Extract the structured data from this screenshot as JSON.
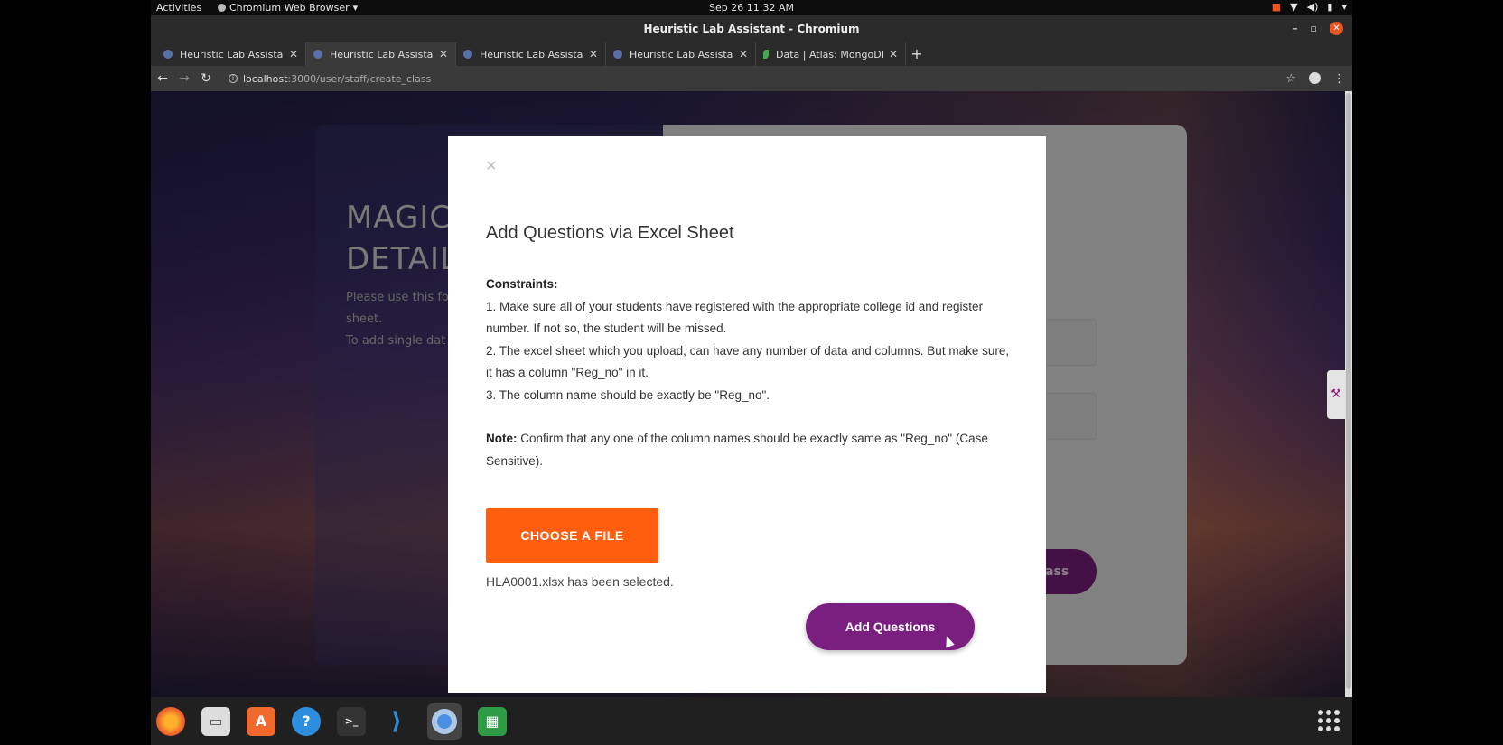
{
  "system": {
    "activities": "Activities",
    "app_menu": "Chromium Web Browser",
    "clock": "Sep 26  11:32 AM"
  },
  "window": {
    "title": "Heuristic Lab Assistant - Chromium"
  },
  "tabs": [
    {
      "label": "Heuristic Lab Assistant",
      "active": false
    },
    {
      "label": "Heuristic Lab Assistant",
      "active": true
    },
    {
      "label": "Heuristic Lab Assistant",
      "active": false
    },
    {
      "label": "Heuristic Lab Assistant",
      "active": false
    },
    {
      "label": "Data | Atlas: MongoDB At",
      "active": false
    }
  ],
  "toolbar": {
    "url_host": "localhost",
    "url_rest": ":3000/user/staff/create_class"
  },
  "background_card": {
    "heading_line1": "MAGIC",
    "heading_line2": "DETAIL",
    "text_line1": "Please use this fo",
    "text_line2": "sheet.",
    "text_line3": "To add single dat",
    "button_label": "Class"
  },
  "modal": {
    "close_symbol": "×",
    "title": "Add Questions via Excel Sheet",
    "constraints_label": "Constraints:",
    "constraint_1": "1. Make sure all of your students have registered with the appropriate college id and register number. If not so, the student will be missed.",
    "constraint_2": "2. The excel sheet which you upload, can have any number of data and columns. But make sure, it has a column \"Reg_no\" in it.",
    "constraint_3": "3. The column name should be exactly be \"Reg_no\".",
    "note_label": "Note:",
    "note_text": " Confirm that any one of the column names should be exactly same as \"Reg_no\" (Case Sensitive).",
    "choose_file_label": "CHOOSE A FILE",
    "selected_file_text": "HLA0001.xlsx has been selected.",
    "add_questions_label": "Add Questions"
  },
  "colors": {
    "accent_orange": "#ff5e0e",
    "accent_purple": "#7a1f80"
  },
  "dock": [
    "firefox-icon",
    "files-icon",
    "software-icon",
    "help-icon",
    "terminal-icon",
    "vscode-icon",
    "chromium-icon",
    "spreadsheet-icon"
  ]
}
